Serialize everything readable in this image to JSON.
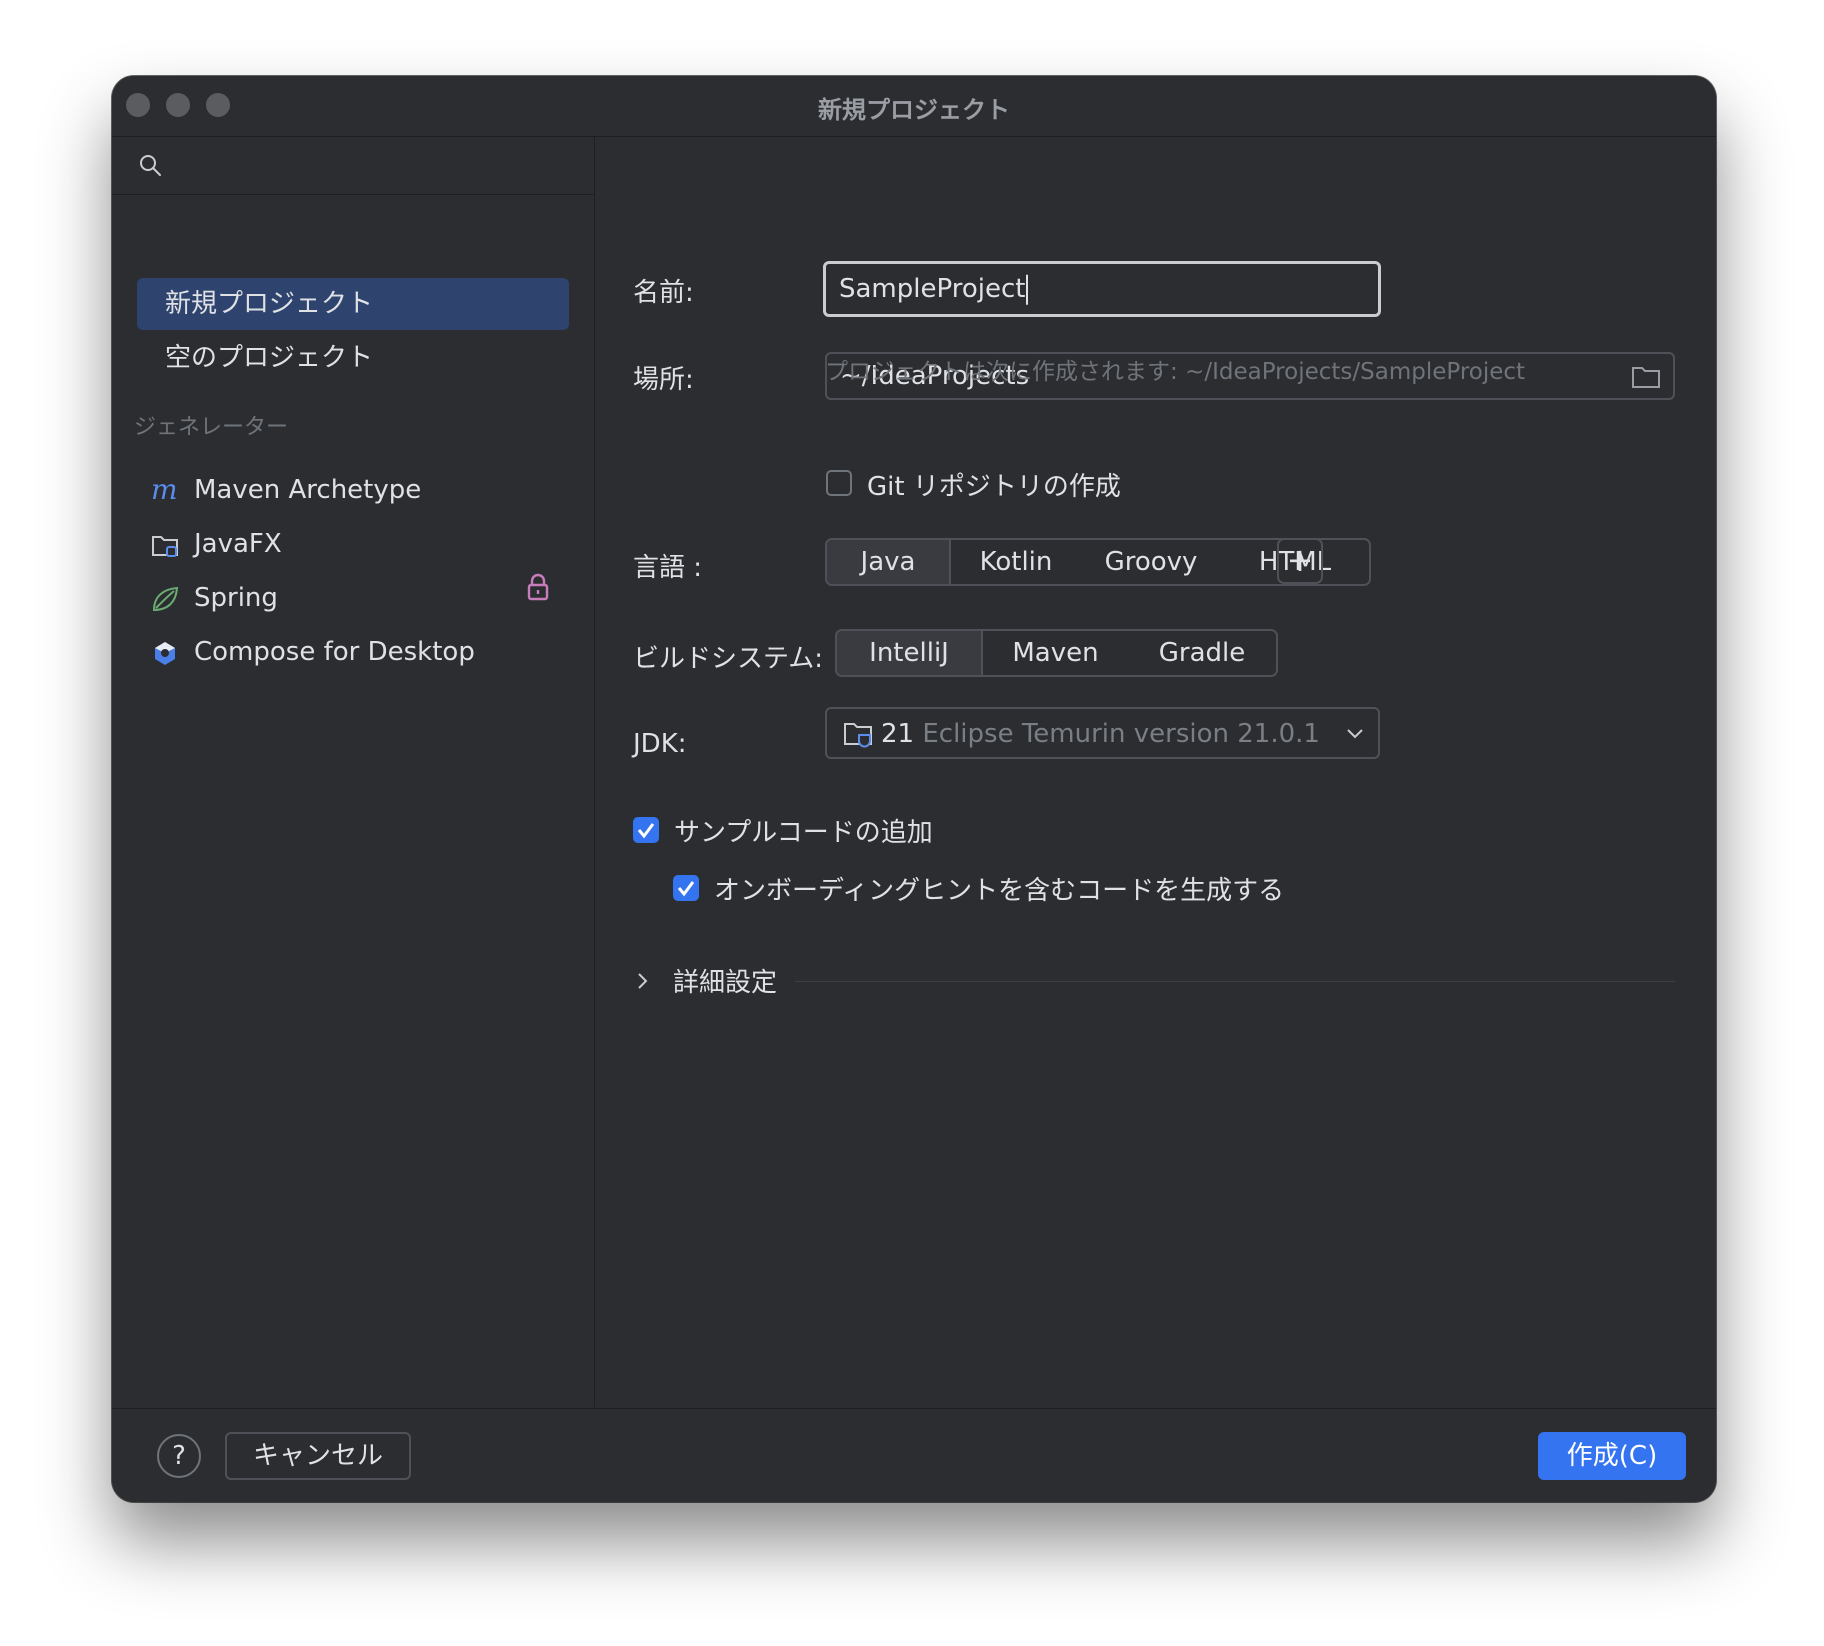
{
  "window": {
    "title": "新規プロジェクト"
  },
  "sidebar": {
    "items": [
      {
        "label": "新規プロジェクト",
        "selected": true
      },
      {
        "label": "空のプロジェクト",
        "selected": false
      }
    ],
    "generators_header": "ジェネレーター",
    "generators": [
      {
        "label": "Maven Archetype",
        "icon": "maven-icon"
      },
      {
        "label": "JavaFX",
        "icon": "folder-icon"
      },
      {
        "label": "Spring",
        "icon": "spring-leaf-icon",
        "locked": true
      },
      {
        "label": "Compose for Desktop",
        "icon": "compose-icon"
      }
    ]
  },
  "form": {
    "name_label": "名前:",
    "name_value": "SampleProject",
    "location_label": "場所:",
    "location_value": "~/IdeaProjects",
    "location_hint": "プロジェクトは次に作成されます: ~/IdeaProjects/SampleProject",
    "git_label": "Git リポジトリの作成",
    "git_checked": false,
    "language_label": "言語 :",
    "languages": [
      "Java",
      "Kotlin",
      "Groovy",
      "HTML"
    ],
    "language_selected": "Java",
    "add_language": "+",
    "build_label": "ビルドシステム:",
    "build_systems": [
      "IntelliJ",
      "Maven",
      "Gradle"
    ],
    "build_selected": "IntelliJ",
    "jdk_label": "JDK:",
    "jdk_version": "21",
    "jdk_name": "Eclipse Temurin version 21.0.1",
    "sample_code_label": "サンプルコードの追加",
    "sample_code_checked": true,
    "onboarding_label": "オンボーディングヒントを含むコードを生成する",
    "onboarding_checked": true,
    "advanced_label": "詳細設定"
  },
  "footer": {
    "help_label": "?",
    "cancel_label": "キャンセル",
    "create_label": "作成(C)"
  },
  "colors": {
    "background": "#2b2d30",
    "accent": "#3574f0",
    "selected_item": "#2e436e",
    "lock": "#c77dbb"
  }
}
